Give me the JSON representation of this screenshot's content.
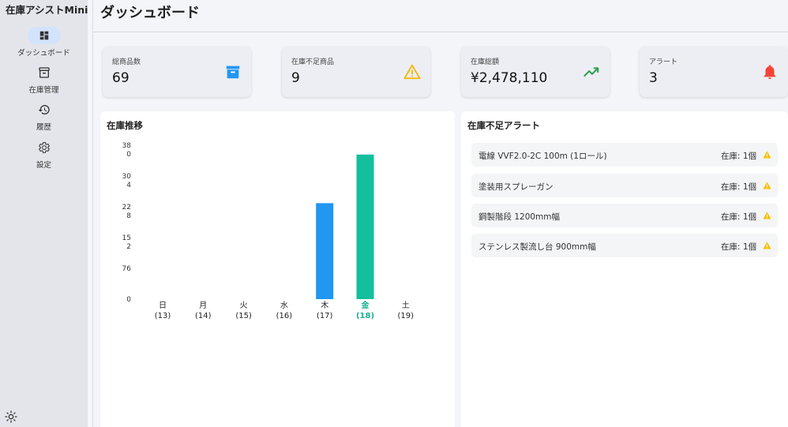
{
  "app": {
    "title": "在庫アシストMini"
  },
  "sidebar": {
    "items": [
      {
        "label": "ダッシュボード",
        "icon": "dashboard-icon",
        "active": true
      },
      {
        "label": "在庫管理",
        "icon": "archive-icon",
        "active": false
      },
      {
        "label": "履歴",
        "icon": "history-icon",
        "active": false
      },
      {
        "label": "設定",
        "icon": "gear-icon",
        "active": false
      }
    ],
    "theme_icon": "sun-icon"
  },
  "header": {
    "title": "ダッシュボード"
  },
  "stats": [
    {
      "label": "総商品数",
      "value": "69",
      "icon": "archive-icon",
      "color": "#2196f3"
    },
    {
      "label": "在庫不足商品",
      "value": "9",
      "icon": "warning-icon",
      "color": "#f5b700"
    },
    {
      "label": "在庫総額",
      "value": "¥2,478,110",
      "icon": "trending-up-icon",
      "color": "#2e9e4f"
    },
    {
      "label": "アラート",
      "value": "3",
      "icon": "bell-icon",
      "color": "#f44336"
    }
  ],
  "trend_panel": {
    "title": "在庫推移"
  },
  "chart_data": {
    "type": "bar",
    "y_tick_labels": [
      "38\n0",
      "30\n4",
      "22\n8",
      "15\n2",
      "76",
      "0"
    ],
    "y_ticks": [
      380,
      304,
      228,
      152,
      76,
      0
    ],
    "ylim": [
      0,
      380
    ],
    "grid": false,
    "categories": [
      "日\n(13)",
      "月\n(14)",
      "火\n(15)",
      "水\n(16)",
      "木\n(17)",
      "金\n(18)",
      "土\n(19)"
    ],
    "values": [
      0,
      0,
      0,
      0,
      237,
      357,
      0
    ],
    "highlight_index": 5,
    "colors": {
      "default": "#2196f3",
      "highlight": "#13bf9c"
    }
  },
  "alerts_panel": {
    "title": "在庫不足アラート",
    "items": [
      {
        "name": "電線 VVF2.0-2C 100m (1ロール)",
        "stock": "在庫: 1個"
      },
      {
        "name": "塗装用スプレーガン",
        "stock": "在庫: 1個"
      },
      {
        "name": "鋼製階段 1200mm幅",
        "stock": "在庫: 1個"
      },
      {
        "name": "ステンレス製流し台 900mm幅",
        "stock": "在庫: 1個"
      }
    ],
    "warning_color": "#f5c000"
  }
}
